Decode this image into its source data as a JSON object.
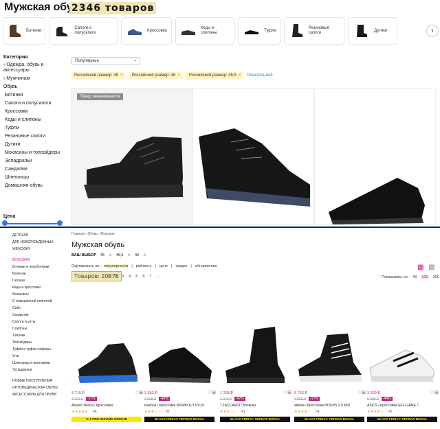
{
  "top": {
    "title": "Мужская обувь",
    "count": "2346 товаров",
    "categories": [
      {
        "label": "Ботинки",
        "icon": "boot-icon"
      },
      {
        "label": "Сапоги и полусапоги",
        "icon": "shoe-icon"
      },
      {
        "label": "Кроссовки",
        "icon": "sneaker-icon"
      },
      {
        "label": "Кеды и слипоны",
        "icon": "slip-on-icon"
      },
      {
        "label": "Туфли",
        "icon": "dress-shoe-icon"
      },
      {
        "label": "Резиновые сапоги",
        "icon": "rubber-boot-icon"
      },
      {
        "label": "Дутики",
        "icon": "puffer-boot-icon"
      }
    ],
    "sidebar": {
      "heading": "Категория",
      "items": [
        "‹ Одежда, обувь и аксессуары",
        "‹ Мужчинам",
        "Обувь",
        "Ботинки",
        "Сапоги и полусапоги",
        "Кроссовки",
        "Кеды и слипоны",
        "Туфли",
        "Резиновые сапоги",
        "Дутики",
        "Мокасины и топсайдеры",
        "Эспадрильи",
        "Сандалии",
        "Шлепанцы",
        "Домашняя обувь"
      ],
      "price_heading": "Цена"
    },
    "sort": "Популярные",
    "chips": [
      "Российский размер: 45",
      "Российский размер: 46",
      "Российский размер: 45,5"
    ],
    "clear_all": "Очистить всё",
    "tag": "Товар заканчивается"
  },
  "bottom": {
    "breadcrumb": "Главная › Обувь › Мужская",
    "title": "Мужская обувь",
    "choice_label": "ВАШ ВЫБОР",
    "choices": [
      "45",
      "45,5",
      "46"
    ],
    "sort_label": "Сортировать по:",
    "sort_options": [
      "популярности",
      "рейтингу",
      "цене",
      "скидке",
      "обновлению"
    ],
    "count": "Товаров: 20376",
    "pages": [
      "1",
      "2",
      "3",
      "4",
      "5",
      "6",
      "7",
      "..."
    ],
    "show_label": "Показывать по:",
    "show_options": [
      "40",
      "100",
      "200"
    ],
    "sidebar": [
      "ДЕТСКАЯ",
      "ДЛЯ НОВОРОЖДЕННЫХ",
      "ЖЕНСКАЯ",
      "МУЖСКАЯ",
      "Ботинки и полуботинки",
      "Валенки",
      "Галоши",
      "Кеды и кроссовки",
      "Мокасины",
      "С повышенной полнотой",
      "Сабо",
      "Сандалии",
      "Сапоги и унты",
      "Слипоны",
      "Тапочки",
      "Топсайдеры",
      "Туфли и туфли-лоферы",
      "Угги",
      "Шлепанцы и вьетнамки",
      "Эспадрильи",
      "НОВЫЕ ПОСТУПЛЕНИЯ",
      "ОРТОПЕДИЧЕСКАЯ ОБУВЬ",
      "АКСЕССУАРЫ ДЛЯ ОБУВИ"
    ],
    "products": [
      {
        "price": "3 719 ₽",
        "old": "4 404 ₽",
        "disc": "-17%",
        "name": "Alessio Nesca / Кроссовки",
        "stars": "★★★★★",
        "reviews": "48",
        "promo": "2+1 ПРИ ОНЛАЙН ОПЛАТЕ",
        "promo_dark": false
      },
      {
        "price": "3 553 ₽",
        "old": "6 098 ₽",
        "disc": "-49%",
        "name": "Reebok / Кроссовки WORKOUT PLUS",
        "stars": "★★★☆☆",
        "reviews": "83",
        "promo": "BLACK FRIDAY: ПЕРВАЯ ВОЛНА",
        "promo_dark": true
      },
      {
        "price": "1 208 ₽",
        "old": "2 279 ₽",
        "disc": "-47%",
        "name": "T.TACCARDI / Ботинки",
        "stars": "★★★☆☆",
        "reviews": "41",
        "promo": "BLACK FRIDAY: ПЕРВАЯ ВОЛНА",
        "promo_dark": true
      },
      {
        "price": "5 763 ₽",
        "old": "6 858 ₽",
        "disc": "-17%",
        "name": "adidas / Кроссовки HOOPS 2.0 MID",
        "stars": "★★★★☆",
        "reviews": "64",
        "promo": "BLACK FRIDAY: ПЕРВАЯ ВОЛНА",
        "promo_dark": true
      },
      {
        "price": "3 309 ₽",
        "old": "5 998 ₽",
        "disc": "-44%",
        "name": "ASICS / Кроссовки GEL-GAME 7",
        "stars": "★★★★☆",
        "reviews": "43",
        "promo": "BLACK FRIDAY: ПЕРВАЯ ВОЛНА",
        "promo_dark": true
      }
    ]
  },
  "colors": {
    "accent_pink": "#c02080",
    "accent_blue": "#2d7de0",
    "highlight": "#f1e6b4"
  }
}
